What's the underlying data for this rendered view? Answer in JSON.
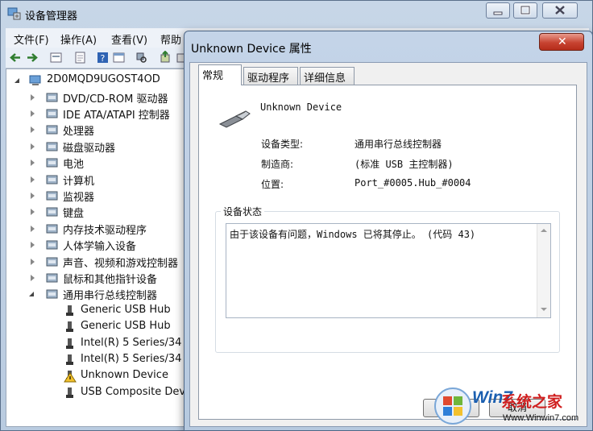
{
  "main_window": {
    "title": "设备管理器",
    "menu": [
      "文件(F)",
      "操作(A)",
      "查看(V)",
      "帮助"
    ],
    "tree": {
      "root": "2D0MQD9UGOST4OD",
      "categories": [
        "DVD/CD-ROM 驱动器",
        "IDE ATA/ATAPI 控制器",
        "处理器",
        "磁盘驱动器",
        "电池",
        "计算机",
        "监视器",
        "键盘",
        "内存技术驱动程序",
        "人体学输入设备",
        "声音、视频和游戏控制器",
        "鼠标和其他指针设备",
        "通用串行总线控制器"
      ],
      "usb_children": [
        "Generic USB Hub",
        "Generic USB Hub",
        "Intel(R) 5 Series/34",
        "Intel(R) 5 Series/34",
        "Unknown Device",
        "USB Composite Dev"
      ]
    }
  },
  "dialog": {
    "title": "Unknown Device 属性",
    "tabs": [
      "常规",
      "驱动程序",
      "详细信息"
    ],
    "device_name": "Unknown Device",
    "properties": {
      "type_label": "设备类型:",
      "type_value": "通用串行总线控制器",
      "mfr_label": "制造商:",
      "mfr_value": "(标准 USB 主控制器)",
      "loc_label": "位置:",
      "loc_value": "Port_#0005.Hub_#0004"
    },
    "status_legend": "设备状态",
    "status_text": "由于该设备有问题，Windows 已将其停止。 (代码 43)",
    "ok_label": "确定",
    "cancel_label": "取消"
  },
  "watermark": {
    "brand": "Win7",
    "site": "系统之家",
    "url": "Www.Winwin7.com"
  },
  "colors": {
    "window_frame": "#b9cbe0",
    "close_red": "#c74331",
    "warning_yellow": "#f2c12e",
    "watermark_blue": "#1b5fb0",
    "watermark_red": "#d01f1f"
  }
}
